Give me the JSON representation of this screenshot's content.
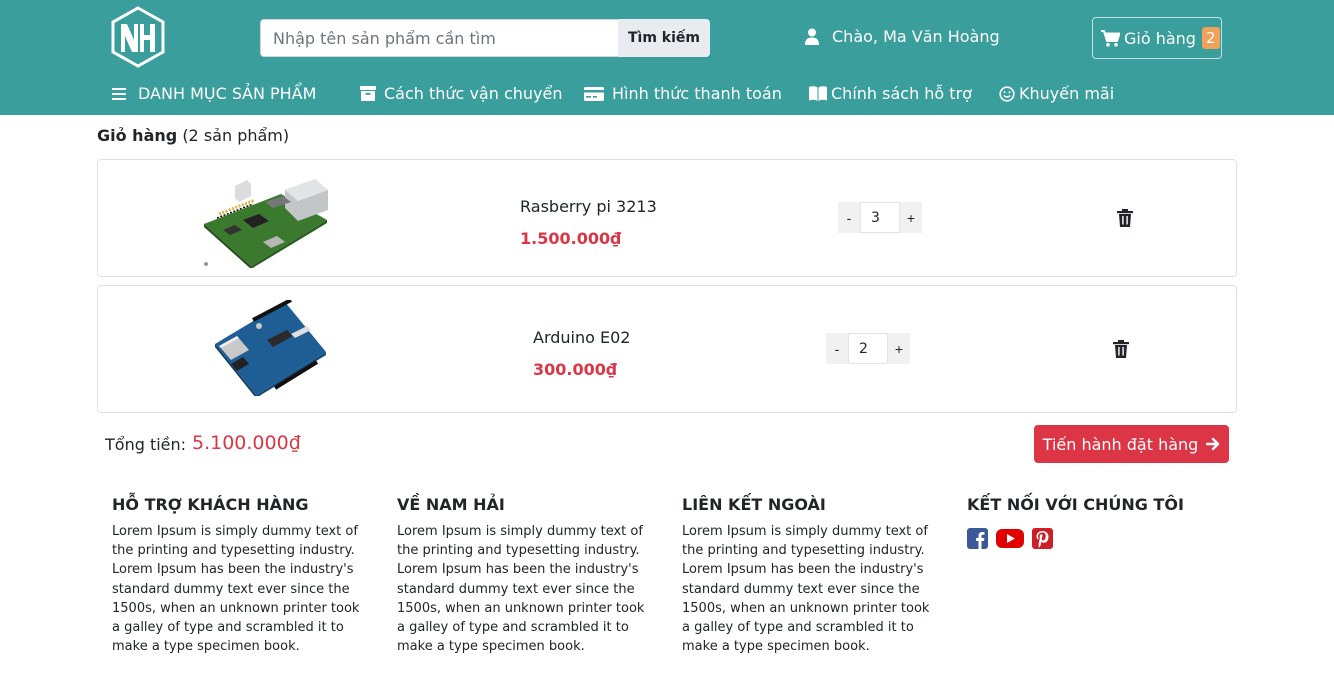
{
  "header": {
    "search_placeholder": "Nhập tên sản phẩm cần tìm",
    "search_button": "Tìm kiếm",
    "greeting": "Chào, Ma Văn Hoàng",
    "cart_label": "Giỏ hàng",
    "cart_count": "2",
    "brand_color": "#3a9e9d"
  },
  "nav": {
    "categories": "DANH MỤC SẢN PHẨM",
    "shipping": "Cách thức vận chuyển",
    "payment": "Hình thức thanh toán",
    "support": "Chính sách hỗ trợ",
    "promo": "Khuyến mãi"
  },
  "cart": {
    "title": "Giỏ hàng",
    "count_text": "(2 sản phẩm)",
    "items": [
      {
        "name": "Rasberry pi 3213",
        "price": "1.500.000₫",
        "quantity": "3"
      },
      {
        "name": "Arduino E02",
        "price": "300.000₫",
        "quantity": "2"
      }
    ],
    "minus": "-",
    "plus": "+",
    "total_label": "Tổng tiền:",
    "total_value": "5.100.000₫",
    "checkout_label": "Tiến hành đặt hàng",
    "accent_color": "#dc3545"
  },
  "footer": {
    "columns": [
      {
        "heading": "HỖ TRỢ KHÁCH HÀNG",
        "text": "Lorem Ipsum is simply dummy text of the printing and typesetting industry. Lorem Ipsum has been the industry's standard dummy text ever since the 1500s, when an unknown printer took a galley of type and scrambled it to make a type specimen book."
      },
      {
        "heading": "VỀ NAM HẢI",
        "text": "Lorem Ipsum is simply dummy text of the printing and typesetting industry. Lorem Ipsum has been the industry's standard dummy text ever since the 1500s, when an unknown printer took a galley of type and scrambled it to make a type specimen book."
      },
      {
        "heading": "LIÊN KẾT NGOÀI",
        "text": "Lorem Ipsum is simply dummy text of the printing and typesetting industry. Lorem Ipsum has been the industry's standard dummy text ever since the 1500s, when an unknown printer took a galley of type and scrambled it to make a type specimen book."
      },
      {
        "heading": "KẾT NỐI VỚI CHÚNG TÔI"
      }
    ],
    "socials": [
      "facebook-icon",
      "youtube-icon",
      "pinterest-icon"
    ]
  }
}
